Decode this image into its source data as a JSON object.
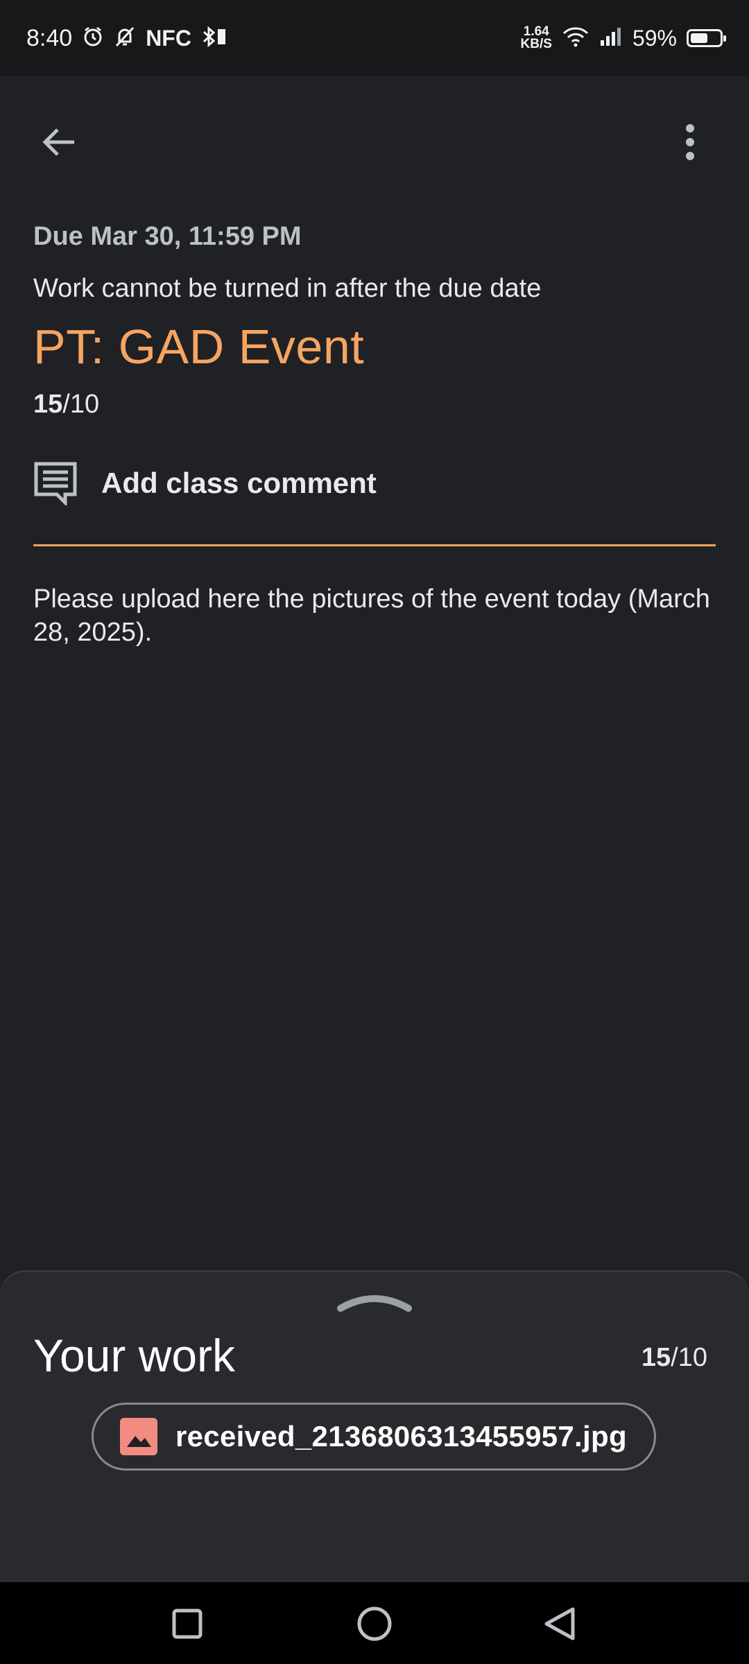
{
  "status_bar": {
    "time": "8:40",
    "nfc": "NFC",
    "speed_value": "1.64",
    "speed_unit": "KB/S",
    "battery_pct": "59%",
    "battery_level": 0.59,
    "icons": [
      "alarm-icon",
      "mute-icon",
      "bluetooth-icon",
      "wifi-icon",
      "signal-icon",
      "battery-icon"
    ]
  },
  "app_bar": {
    "back_icon": "arrow-back-icon",
    "menu_icon": "more-vert-icon"
  },
  "assignment": {
    "due": "Due Mar 30, 11:59 PM",
    "late_note": "Work cannot be turned in after the due date",
    "title": "PT: GAD Event",
    "grade": "15",
    "max_points": "/10",
    "comment_label": "Add class comment",
    "description": "Please upload here the pictures of the event today (March 28, 2025)."
  },
  "your_work": {
    "heading": "Your work",
    "grade": "15",
    "max_points": "/10",
    "attachment_name": "received_2136806313455957.jpg"
  },
  "colors": {
    "accent": "#f6a561",
    "background": "#202124",
    "sheet": "#292a2d",
    "image_icon": "#f28b82"
  }
}
